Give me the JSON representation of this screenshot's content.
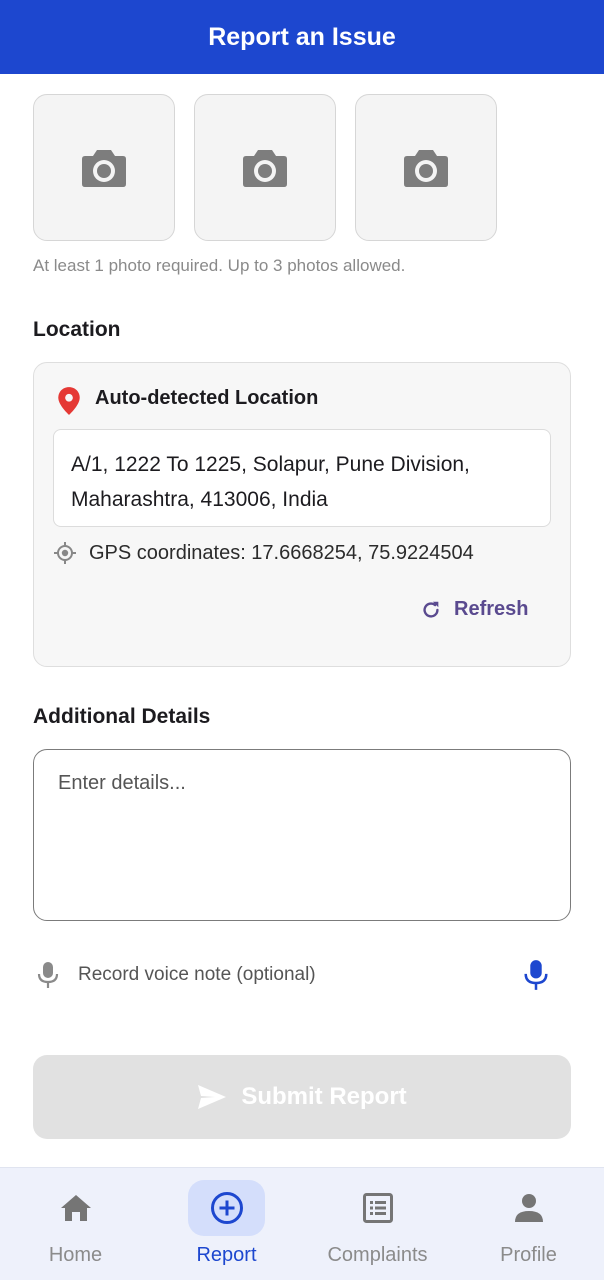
{
  "header": {
    "title": "Report an Issue"
  },
  "photos": {
    "slots": [
      "camera-icon",
      "camera-icon",
      "camera-icon"
    ],
    "helper_text": "At least 1 photo required. Up to 3 photos allowed."
  },
  "location": {
    "section_title": "Location",
    "card_title": "Auto-detected Location",
    "address": "A/1, 1222 To 1225, Solapur, Pune Division, Maharashtra, 413006, India",
    "gps_text": "GPS coordinates: 17.6668254, 75.9224504",
    "refresh_label": "Refresh"
  },
  "details": {
    "section_title": "Additional Details",
    "placeholder": "Enter details...",
    "voice_label": "Record voice note (optional)"
  },
  "submit": {
    "label": "Submit Report"
  },
  "nav": {
    "items": [
      {
        "label": "Home",
        "icon": "home-icon",
        "active": false
      },
      {
        "label": "Report",
        "icon": "add-circle-icon",
        "active": true
      },
      {
        "label": "Complaints",
        "icon": "list-icon",
        "active": false
      },
      {
        "label": "Profile",
        "icon": "person-icon",
        "active": false
      }
    ]
  },
  "colors": {
    "primary": "#1d47cf",
    "location_pin": "#e53935",
    "refresh": "#5a4a8f",
    "disabled_button": "#e1e1e1"
  }
}
